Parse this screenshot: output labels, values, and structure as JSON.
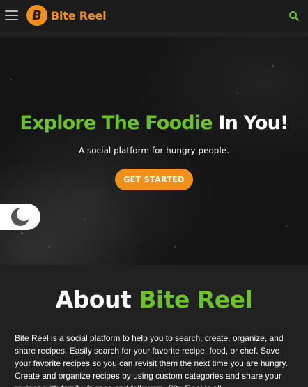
{
  "navbar": {
    "menu_icon": "hamburger-icon",
    "logo_letter": "B",
    "brand_name": "Bite Reel",
    "search_icon": "search-icon",
    "brand_color": "#f0901a",
    "accent_color": "#6cc02a"
  },
  "hero": {
    "title_green": "Explore The Foodie",
    "title_white": "In You!",
    "subtitle": "A social platform for hungry people.",
    "cta_label": "GET STARTED",
    "theme_toggle_icon": "moon-icon"
  },
  "about": {
    "title_white": "About",
    "title_green": "Bite Reel",
    "body": "Bite Reel is a social platform to help you to search, create, organize, and share recipes. Easily search for your favorite recipe, food, or chef. Save your favorite recipes so you can revisit them the next time you are hungry. Create and organize recipes by using custom categories and share your recipes with family, friends and followers. Bite Reel is all"
  }
}
